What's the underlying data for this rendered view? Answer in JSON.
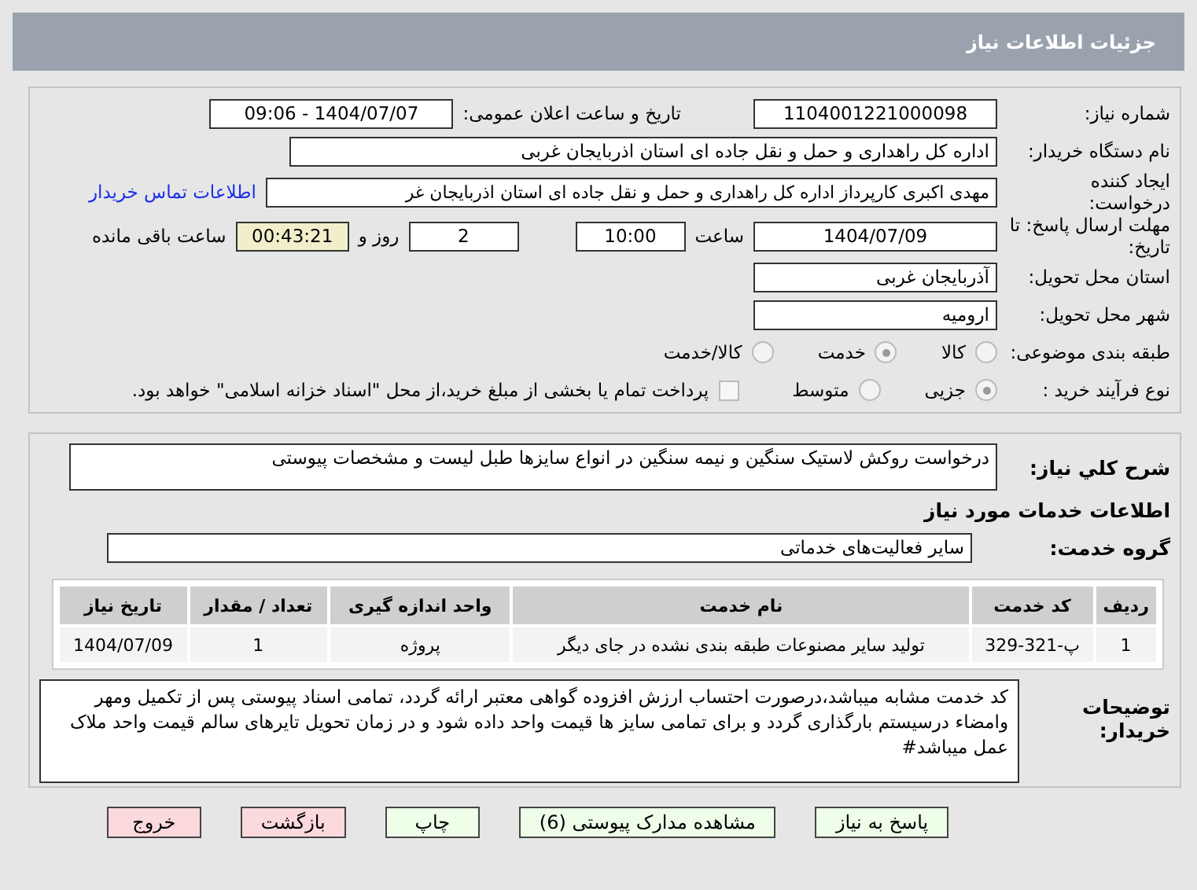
{
  "header": {
    "title": "جزئیات اطلاعات نیاز"
  },
  "need_number": {
    "label": "شماره نیاز:",
    "value": "1104001221000098"
  },
  "announce": {
    "label": "تاریخ و ساعت اعلان عمومی:",
    "value": "1404/07/07 - 09:06"
  },
  "buyer": {
    "label": "نام دستگاه خریدار:",
    "value": "اداره کل راهداری و حمل و نقل جاده ای استان اذربایجان غربی"
  },
  "creator": {
    "label": "ایجاد کننده درخواست:",
    "value": "مهدی اکبری کارپرداز اداره کل راهداری و حمل و نقل جاده ای استان اذربایجان غر",
    "link": "اطلاعات تماس خریدار"
  },
  "deadline": {
    "label": "مهلت ارسال پاسخ: تا تاریخ:",
    "date": "1404/07/09",
    "time_label": "ساعت",
    "time": "10:00",
    "days": "2",
    "days_label": "روز و",
    "remaining": "00:43:21",
    "remaining_label": "ساعت باقی مانده"
  },
  "province": {
    "label": "استان محل تحویل:",
    "value": "آذربایجان غربی"
  },
  "city": {
    "label": "شهر محل تحویل:",
    "value": "ارومیه"
  },
  "category": {
    "label": "طبقه بندی موضوعی:",
    "options": [
      {
        "label": "کالا",
        "selected": false
      },
      {
        "label": "خدمت",
        "selected": true
      },
      {
        "label": "کالا/خدمت",
        "selected": false
      }
    ]
  },
  "process": {
    "label": "نوع فرآیند خرید :",
    "options": [
      {
        "label": "جزیی",
        "selected": true
      },
      {
        "label": "متوسط",
        "selected": false
      }
    ],
    "payment": {
      "checked": false,
      "label": "پرداخت تمام یا بخشی از مبلغ خرید،از محل \"اسناد خزانه اسلامی\" خواهد بود."
    }
  },
  "summary": {
    "label": "شرح کلي نياز:",
    "value": "درخواست روکش لاستیک  سنگین و نیمه سنگین در انواع سایزها طبل لیست و مشخصات پیوستی"
  },
  "services_heading": "اطلاعات خدمات مورد نیاز",
  "service_group": {
    "label": "گروه خدمت:",
    "value": "سایر فعالیت‌های خدماتی"
  },
  "table": {
    "columns": [
      "ردیف",
      "کد خدمت",
      "نام خدمت",
      "واحد اندازه گیری",
      "تعداد / مقدار",
      "تاریخ نیاز"
    ],
    "rows": [
      [
        "1",
        "پ-321-329",
        "تولید سایر مصنوعات طبقه بندی نشده در جای دیگر",
        "پروژه",
        "1",
        "1404/07/09"
      ]
    ]
  },
  "notes": {
    "label": "توضیحات خریدار:",
    "value": "کد خدمت مشابه میباشد،درصورت احتساب ارزش افزوده گواهی معتبر ارائه گردد،  تمامی اسناد پیوستی پس از تکمیل ومهر وامضاء درسیستم بارگذاری گردد و برای تمامی سایز ها قیمت واحد داده شود و در زمان تحویل تایرهای سالم قیمت واحد ملاک عمل میباشد#"
  },
  "buttons": [
    {
      "label": "پاسخ به نیاز",
      "kind": "action"
    },
    {
      "label": "مشاهده مدارک پیوستی (6)",
      "kind": "action"
    },
    {
      "label": "چاپ",
      "kind": "action"
    },
    {
      "label": "بازگشت",
      "kind": "exit"
    },
    {
      "label": "خروج",
      "kind": "exit"
    }
  ]
}
